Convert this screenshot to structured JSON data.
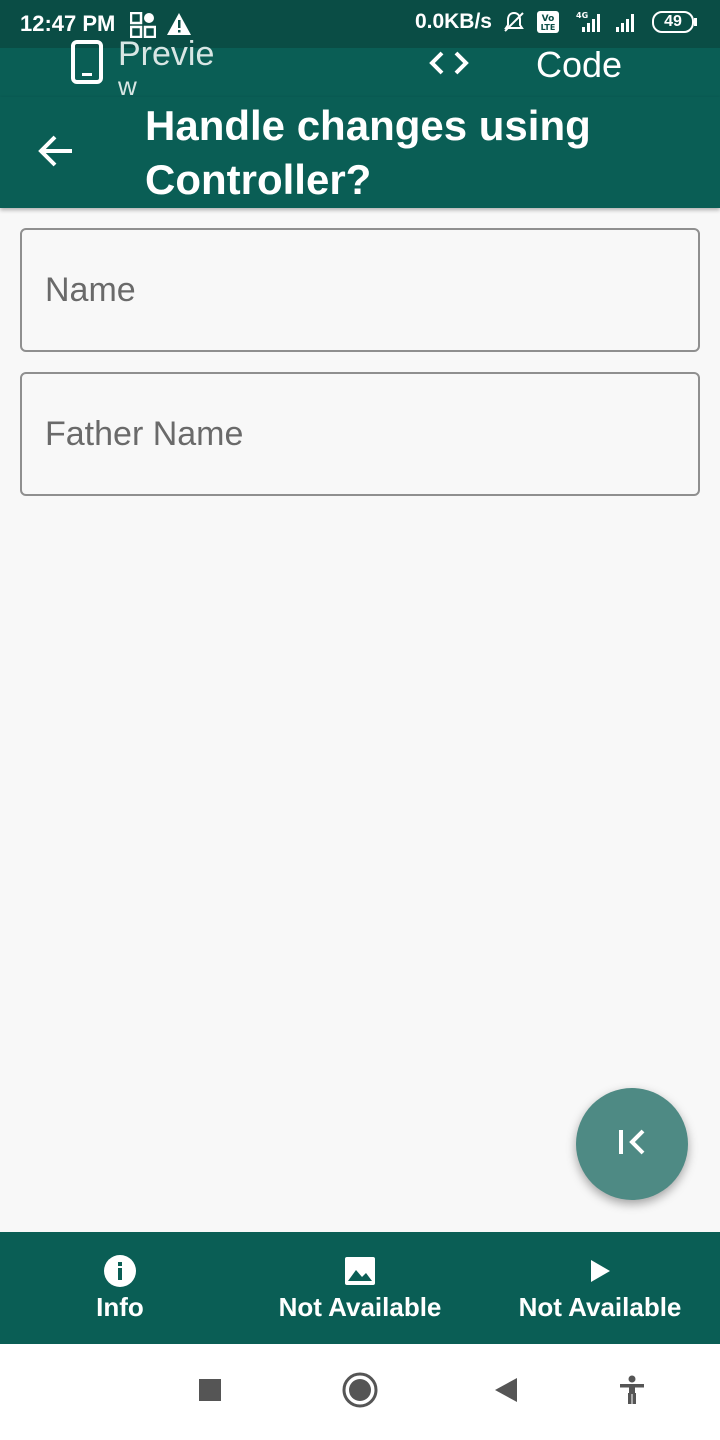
{
  "status_bar": {
    "time": "12:47 PM",
    "net_speed": "0.0KB/s",
    "battery": "49",
    "icons": [
      "grid-apps-icon",
      "warning-icon",
      "mute-bell-icon",
      "volte-icon",
      "signal-4g-icon",
      "signal-icon",
      "battery-icon"
    ]
  },
  "tabs": {
    "preview_label_line1": "Previe",
    "preview_label_line2": "w",
    "code_label": "Code",
    "preview_icon": "phone-icon",
    "code_icon": "code-brackets-icon"
  },
  "appbar": {
    "title": "Handle changes using Controller?",
    "back_icon": "arrow-back-icon"
  },
  "form": {
    "name_placeholder": "Name",
    "father_name_placeholder": "Father Name"
  },
  "fab": {
    "icon": "first-page-icon"
  },
  "bottom_nav": {
    "items": [
      {
        "label": "Info",
        "icon": "info-icon"
      },
      {
        "label": "Not Available",
        "icon": "image-icon"
      },
      {
        "label": "Not Available",
        "icon": "play-icon"
      }
    ]
  },
  "system_nav": {
    "icons": [
      "recents-square-icon",
      "home-circle-icon",
      "back-triangle-icon",
      "accessibility-icon"
    ]
  },
  "colors": {
    "primary": "#0a5e55",
    "status": "#0a4d45",
    "fab": "#4e8a84",
    "background": "#f8f8f8"
  }
}
